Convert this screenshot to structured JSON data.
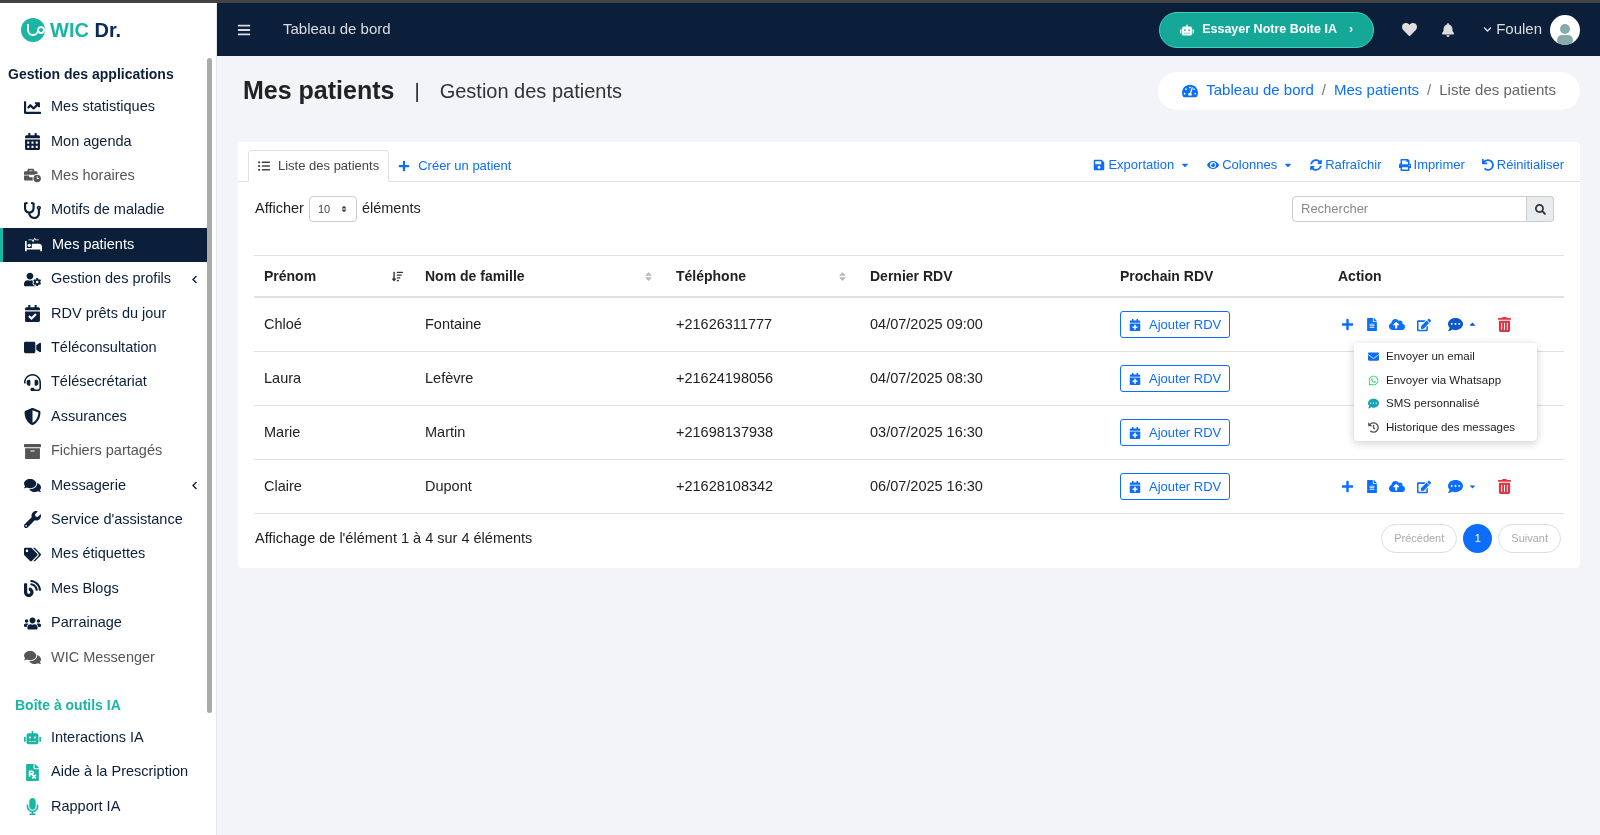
{
  "logo": {
    "text": "WIC",
    "accent": "Dr."
  },
  "sidebar": {
    "sections": [
      {
        "title": "Gestion des applications",
        "kind": "main",
        "items": [
          {
            "label": "Mes statistiques",
            "selected": false,
            "muted": false,
            "has_submenu": false
          },
          {
            "label": "Mon agenda",
            "selected": false,
            "muted": false,
            "has_submenu": false
          },
          {
            "label": "Mes horaires",
            "selected": false,
            "muted": true,
            "has_submenu": false
          },
          {
            "label": "Motifs de maladie",
            "selected": false,
            "muted": false,
            "has_submenu": false
          },
          {
            "label": "Mes patients",
            "selected": true,
            "muted": false,
            "has_submenu": false
          },
          {
            "label": "Gestion des profils",
            "selected": false,
            "muted": false,
            "has_submenu": true
          },
          {
            "label": "RDV prêts du jour",
            "selected": false,
            "muted": false,
            "has_submenu": false
          },
          {
            "label": "Téléconsultation",
            "selected": false,
            "muted": false,
            "has_submenu": false
          },
          {
            "label": "Télésecrétariat",
            "selected": false,
            "muted": false,
            "has_submenu": false
          },
          {
            "label": "Assurances",
            "selected": false,
            "muted": false,
            "has_submenu": false
          },
          {
            "label": "Fichiers partagés",
            "selected": false,
            "muted": true,
            "has_submenu": false
          },
          {
            "label": "Messagerie",
            "selected": false,
            "muted": false,
            "has_submenu": true
          },
          {
            "label": "Service d'assistance",
            "selected": false,
            "muted": false,
            "has_submenu": false
          },
          {
            "label": "Mes étiquettes",
            "selected": false,
            "muted": false,
            "has_submenu": false
          },
          {
            "label": "Mes Blogs",
            "selected": false,
            "muted": false,
            "has_submenu": false
          },
          {
            "label": "Parrainage",
            "selected": false,
            "muted": false,
            "has_submenu": false
          },
          {
            "label": "WIC Messenger",
            "selected": false,
            "muted": true,
            "has_submenu": false
          }
        ]
      },
      {
        "title": "Boîte à outils IA",
        "kind": "ai",
        "items": [
          {
            "label": "Interactions IA",
            "selected": false,
            "muted": false,
            "has_submenu": false
          },
          {
            "label": "Aide à la Prescription",
            "selected": false,
            "muted": false,
            "has_submenu": false
          },
          {
            "label": "Rapport IA",
            "selected": false,
            "muted": false,
            "has_submenu": false
          }
        ]
      }
    ]
  },
  "topbar": {
    "title": "Tableau de bord",
    "ai_button": "Essayer Notre Boite IA",
    "ai_chevron": "›",
    "user": "Foulen"
  },
  "page": {
    "title": "Mes patients",
    "divider": "|",
    "subtitle": "Gestion des patients",
    "separator": "/",
    "breadcrumb": [
      {
        "label": "Tableau de bord",
        "kind": "link"
      },
      {
        "label": "Mes patients",
        "kind": "link"
      },
      {
        "label": "Liste des patients",
        "kind": "current"
      }
    ]
  },
  "tabs": [
    {
      "label": "Liste des patients",
      "selected": true
    },
    {
      "label": "Créer un patient",
      "selected": false
    }
  ],
  "toolbar": [
    {
      "label": "Exportation",
      "dropdown": true
    },
    {
      "label": "Colonnes",
      "dropdown": true
    },
    {
      "label": "Rafraîchir",
      "dropdown": false
    },
    {
      "label": "Imprimer",
      "dropdown": false
    },
    {
      "label": "Réinitialiser",
      "dropdown": false
    }
  ],
  "length": {
    "before": "Afficher",
    "value": "10",
    "after": "éléments"
  },
  "search": {
    "placeholder": "Rechercher"
  },
  "table": {
    "columns": [
      {
        "label": "Prénom",
        "sortable": true,
        "sorted": true
      },
      {
        "label": "Nom de famille",
        "sortable": true,
        "sorted": false
      },
      {
        "label": "Téléphone",
        "sortable": true,
        "sorted": false
      },
      {
        "label": "Dernier RDV"
      },
      {
        "label": "Prochain RDV"
      },
      {
        "label": "Action"
      }
    ],
    "rows": [
      {
        "first": "Chloé",
        "last": "Fontaine",
        "phone": "+21626311777",
        "last_rdv": "04/07/2025 09:00",
        "button": "Ajouter RDV",
        "menu_open": true
      },
      {
        "first": "Laura",
        "last": "Lefèvre",
        "phone": "+21624198056",
        "last_rdv": "04/07/2025 08:30",
        "button": "Ajouter RDV",
        "menu_open": false
      },
      {
        "first": "Marie",
        "last": "Martin",
        "phone": "+21698137938",
        "last_rdv": "03/07/2025 16:30",
        "button": "Ajouter RDV",
        "menu_open": false
      },
      {
        "first": "Claire",
        "last": "Dupont",
        "phone": "+21628108342",
        "last_rdv": "06/07/2025 16:30",
        "button": "Ajouter RDV",
        "menu_open": false
      }
    ]
  },
  "message_menu": {
    "items": [
      {
        "label": "Envoyer un email",
        "kind": "email"
      },
      {
        "label": "Envoyer via Whatsapp",
        "kind": "whatsapp"
      },
      {
        "label": "SMS personnalisé",
        "kind": "sms"
      },
      {
        "label": "Historique des messages",
        "kind": "history"
      }
    ]
  },
  "footer": {
    "info": "Affichage de l'élément 1 à 4 sur 4 éléments",
    "pages": [
      {
        "label": "Précédent",
        "kind": "prev",
        "disabled": true
      },
      {
        "label": "1",
        "kind": "page",
        "selected": true
      },
      {
        "label": "Suivant",
        "kind": "next",
        "disabled": true
      }
    ]
  }
}
